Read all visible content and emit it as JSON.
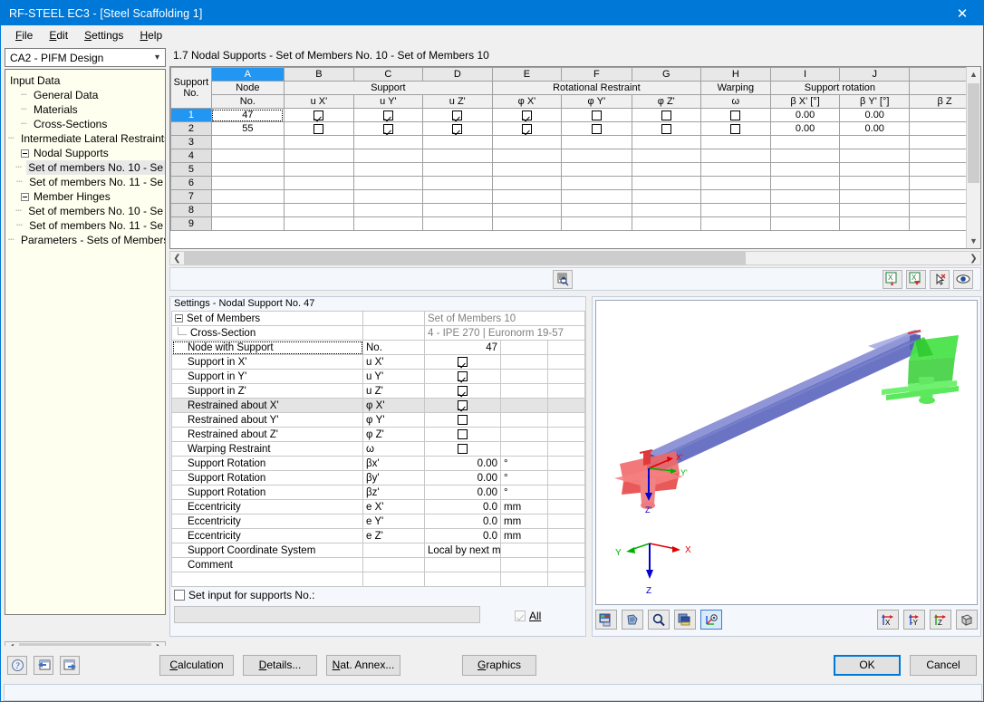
{
  "window": {
    "title": "RF-STEEL EC3 - [Steel Scaffolding 1]",
    "close_icon": "close-icon"
  },
  "menubar": [
    {
      "label": "File",
      "accel": "F"
    },
    {
      "label": "Edit",
      "accel": "E"
    },
    {
      "label": "Settings",
      "accel": "S"
    },
    {
      "label": "Help",
      "accel": "H"
    }
  ],
  "sidebar": {
    "combo_value": "CA2 - PIFM Design",
    "tree": [
      {
        "label": "Input Data",
        "level": 0,
        "marker": "none",
        "selected": false
      },
      {
        "label": "General Data",
        "level": 1,
        "marker": "dash",
        "selected": false
      },
      {
        "label": "Materials",
        "level": 1,
        "marker": "dash",
        "selected": false
      },
      {
        "label": "Cross-Sections",
        "level": 1,
        "marker": "dash",
        "selected": false
      },
      {
        "label": "Intermediate Lateral Restraints",
        "level": 1,
        "marker": "dash",
        "selected": false
      },
      {
        "label": "Nodal Supports",
        "level": 1,
        "marker": "expander",
        "selected": false
      },
      {
        "label": "Set of members No. 10 - Se",
        "level": 2,
        "marker": "dash",
        "selected": true
      },
      {
        "label": "Set of members No. 11 - Se",
        "level": 2,
        "marker": "dash",
        "selected": false
      },
      {
        "label": "Member Hinges",
        "level": 1,
        "marker": "expander",
        "selected": false
      },
      {
        "label": "Set of members No. 10 - Se",
        "level": 2,
        "marker": "dash",
        "selected": false
      },
      {
        "label": "Set of members No. 11 - Se",
        "level": 2,
        "marker": "dash",
        "selected": false
      },
      {
        "label": "Parameters - Sets of Members",
        "level": 1,
        "marker": "dash",
        "selected": false
      }
    ]
  },
  "main": {
    "section_title": "1.7 Nodal Supports - Set of Members No. 10 - Set of Members 10",
    "grid": {
      "corner_header_line1": "Support",
      "corner_header_line2": "No.",
      "column_letters": [
        "A",
        "B",
        "C",
        "D",
        "E",
        "F",
        "G",
        "H",
        "I",
        "J",
        ""
      ],
      "active_column_letter": "A",
      "group_headers": [
        {
          "label": "Node",
          "span": 1
        },
        {
          "label": "Support",
          "span": 3
        },
        {
          "label": "Rotational Restraint",
          "span": 3
        },
        {
          "label": "Warping",
          "span": 1
        },
        {
          "label": "Support rotation",
          "span": 2
        },
        {
          "label": "",
          "span": 1
        }
      ],
      "sub_headers": [
        "No.",
        "u X'",
        "u Y'",
        "u Z'",
        "φ X'",
        "φ Y'",
        "φ Z'",
        "ω",
        "β X' [°]",
        "β Y' [°]",
        "β Z"
      ],
      "rows": [
        {
          "no": "1",
          "selected": true,
          "node": "47",
          "ux": true,
          "uy": true,
          "uz": true,
          "px": true,
          "py": false,
          "pz": false,
          "w": false,
          "bx": "0.00",
          "by": "0.00"
        },
        {
          "no": "2",
          "selected": false,
          "node": "55",
          "ux": false,
          "uy": true,
          "uz": true,
          "px": true,
          "py": false,
          "pz": false,
          "w": false,
          "bx": "0.00",
          "by": "0.00"
        },
        {
          "no": "3",
          "selected": false,
          "node": "",
          "ux": null,
          "uy": null,
          "uz": null,
          "px": null,
          "py": null,
          "pz": null,
          "w": null,
          "bx": "",
          "by": ""
        },
        {
          "no": "4",
          "selected": false,
          "node": "",
          "ux": null,
          "uy": null,
          "uz": null,
          "px": null,
          "py": null,
          "pz": null,
          "w": null,
          "bx": "",
          "by": ""
        },
        {
          "no": "5",
          "selected": false,
          "node": "",
          "ux": null,
          "uy": null,
          "uz": null,
          "px": null,
          "py": null,
          "pz": null,
          "w": null,
          "bx": "",
          "by": ""
        },
        {
          "no": "6",
          "selected": false,
          "node": "",
          "ux": null,
          "uy": null,
          "uz": null,
          "px": null,
          "py": null,
          "pz": null,
          "w": null,
          "bx": "",
          "by": ""
        },
        {
          "no": "7",
          "selected": false,
          "node": "",
          "ux": null,
          "uy": null,
          "uz": null,
          "px": null,
          "py": null,
          "pz": null,
          "w": null,
          "bx": "",
          "by": ""
        },
        {
          "no": "8",
          "selected": false,
          "node": "",
          "ux": null,
          "uy": null,
          "uz": null,
          "px": null,
          "py": null,
          "pz": null,
          "w": null,
          "bx": "",
          "by": ""
        },
        {
          "no": "9",
          "selected": false,
          "node": "",
          "ux": null,
          "uy": null,
          "uz": null,
          "px": null,
          "py": null,
          "pz": null,
          "w": null,
          "bx": "",
          "by": ""
        }
      ]
    },
    "grid_toolbar": [
      {
        "name": "view-table-icon"
      },
      {
        "name": "export-excel-up-icon"
      },
      {
        "name": "export-excel-down-icon"
      },
      {
        "name": "pick-in-model-icon"
      },
      {
        "name": "visibility-eye-icon"
      }
    ]
  },
  "settings": {
    "header": "Settings - Nodal Support No. 47",
    "rows": [
      {
        "label": "Set of Members",
        "icon": "minus-box",
        "indent": 0,
        "symbol": "",
        "value": "Set of Members 10",
        "value_style": "grey",
        "unit": "",
        "shaded": false
      },
      {
        "label": "Cross-Section",
        "icon": "corner",
        "indent": 1,
        "symbol": "",
        "value": "4 - IPE 270 | Euronorm 19-57",
        "value_style": "grey",
        "unit": "",
        "shaded": false
      },
      {
        "label": "Node with Support",
        "icon": "",
        "indent": 1,
        "symbol": "No.",
        "value": "47",
        "value_style": "num",
        "unit": "",
        "shaded": false,
        "focus": true
      },
      {
        "label": "Support in X'",
        "icon": "",
        "indent": 1,
        "symbol": "u X'",
        "value": true,
        "value_style": "check",
        "unit": "",
        "shaded": false
      },
      {
        "label": "Support in Y'",
        "icon": "",
        "indent": 1,
        "symbol": "u Y'",
        "value": true,
        "value_style": "check",
        "unit": "",
        "shaded": false
      },
      {
        "label": "Support in Z'",
        "icon": "",
        "indent": 1,
        "symbol": "u Z'",
        "value": true,
        "value_style": "check",
        "unit": "",
        "shaded": false
      },
      {
        "label": "Restrained about X'",
        "icon": "",
        "indent": 1,
        "symbol": "φ X'",
        "value": true,
        "value_style": "check",
        "unit": "",
        "shaded": true
      },
      {
        "label": "Restrained about Y'",
        "icon": "",
        "indent": 1,
        "symbol": "φ Y'",
        "value": false,
        "value_style": "check",
        "unit": "",
        "shaded": false
      },
      {
        "label": "Restrained about Z'",
        "icon": "",
        "indent": 1,
        "symbol": "φ Z'",
        "value": false,
        "value_style": "check",
        "unit": "",
        "shaded": false
      },
      {
        "label": "Warping Restraint",
        "icon": "",
        "indent": 1,
        "symbol": "ω",
        "value": false,
        "value_style": "check",
        "unit": "",
        "shaded": false
      },
      {
        "label": "Support Rotation",
        "icon": "",
        "indent": 1,
        "symbol": "βx'",
        "value": "0.00",
        "value_style": "num",
        "unit": "°",
        "shaded": false
      },
      {
        "label": "Support Rotation",
        "icon": "",
        "indent": 1,
        "symbol": "βy'",
        "value": "0.00",
        "value_style": "num",
        "unit": "°",
        "shaded": false
      },
      {
        "label": "Support Rotation",
        "icon": "",
        "indent": 1,
        "symbol": "βz'",
        "value": "0.00",
        "value_style": "num",
        "unit": "°",
        "shaded": false
      },
      {
        "label": "Eccentricity",
        "icon": "",
        "indent": 1,
        "symbol": "e X'",
        "value": "0.0",
        "value_style": "num",
        "unit": "mm",
        "shaded": false
      },
      {
        "label": "Eccentricity",
        "icon": "",
        "indent": 1,
        "symbol": "e Y'",
        "value": "0.0",
        "value_style": "num",
        "unit": "mm",
        "shaded": false
      },
      {
        "label": "Eccentricity",
        "icon": "",
        "indent": 1,
        "symbol": "e Z'",
        "value": "0.0",
        "value_style": "num",
        "unit": "mm",
        "shaded": false
      },
      {
        "label": "Support Coordinate System",
        "icon": "",
        "indent": 1,
        "symbol": "",
        "value": "Local by next m",
        "value_style": "text",
        "unit": "",
        "shaded": false
      },
      {
        "label": "Comment",
        "icon": "",
        "indent": 1,
        "symbol": "",
        "value": "",
        "value_style": "text",
        "unit": "",
        "shaded": false
      },
      {
        "label": "",
        "icon": "",
        "indent": 1,
        "symbol": "",
        "value": "",
        "value_style": "text",
        "unit": "",
        "shaded": false
      }
    ],
    "set_input_label": "Set input for supports No.:",
    "set_input_checked": false,
    "set_input_value": "",
    "all_label": "All",
    "all_checked": true
  },
  "view3d": {
    "toolbar_left": [
      {
        "name": "render-mode-icon",
        "active": false
      },
      {
        "name": "rotate-icon",
        "active": false
      },
      {
        "name": "zoom-icon",
        "active": false
      },
      {
        "name": "layers-icon",
        "active": false
      },
      {
        "name": "axes-view-icon",
        "active": true
      }
    ],
    "toolbar_right": [
      {
        "name": "view-x-icon",
        "label": "X"
      },
      {
        "name": "view-negy-icon",
        "label": "-Y"
      },
      {
        "name": "view-z-icon",
        "label": "Z"
      },
      {
        "name": "isometric-view-icon",
        "label": ""
      }
    ],
    "axis_labels": {
      "global_x": "X",
      "global_y": "Y",
      "global_z": "Z",
      "local_x": "X'",
      "local_y": "Y'",
      "local_z": "Z'"
    },
    "colors": {
      "beam": "#6b74c4",
      "support_start": "#e84b4b",
      "support_end": "#3fd23f",
      "axis_x": "#e00000",
      "axis_y": "#00b000",
      "axis_z": "#0000d0"
    }
  },
  "bottom": {
    "icon_buttons": [
      {
        "name": "help-question-icon"
      },
      {
        "name": "previous-module-icon"
      },
      {
        "name": "next-module-icon"
      }
    ],
    "buttons": [
      {
        "label": "Calculation",
        "accel": "C",
        "name": "calculation-button"
      },
      {
        "label": "Details...",
        "accel": "D",
        "name": "details-button"
      },
      {
        "label": "Nat. Annex...",
        "accel": "N",
        "name": "national-annex-button"
      },
      {
        "label": "Graphics",
        "accel": "G",
        "name": "graphics-button"
      }
    ],
    "ok_label": "OK",
    "cancel_label": "Cancel"
  }
}
